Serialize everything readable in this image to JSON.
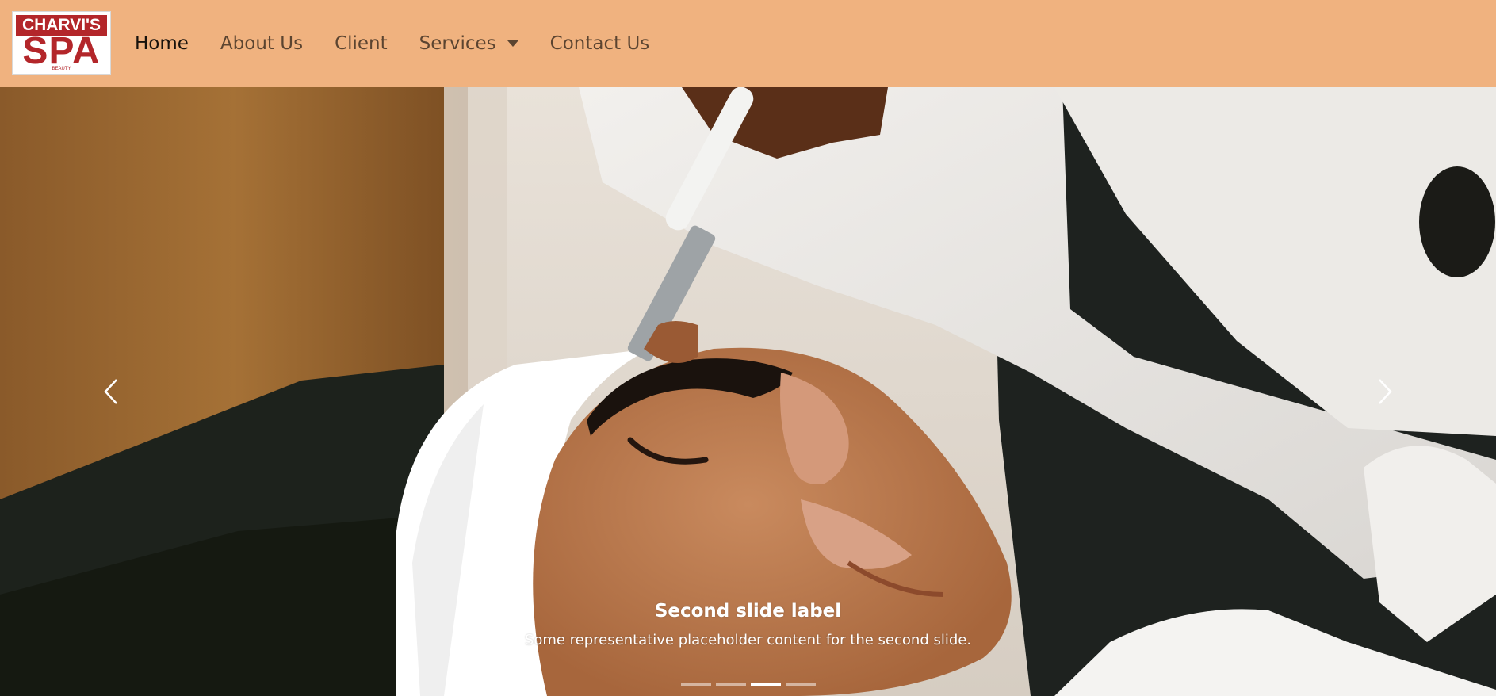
{
  "brand": {
    "logo_top": "CHARVI'S",
    "logo_main": "SPA",
    "logo_sub": "BEAUTY",
    "logo_color": "#b3262a"
  },
  "navbar": {
    "background": "#f0b27f",
    "links": {
      "home": "Home",
      "about": "About Us",
      "client": "Client",
      "services": "Services",
      "contact": "Contact Us"
    },
    "active": "Home"
  },
  "carousel": {
    "slide_title": "Second slide label",
    "slide_text": "Some representative placeholder content for the second slide.",
    "indicator_count": 4,
    "active_index": 2,
    "prev_icon": "chevron-left-icon",
    "next_icon": "chevron-right-icon"
  }
}
